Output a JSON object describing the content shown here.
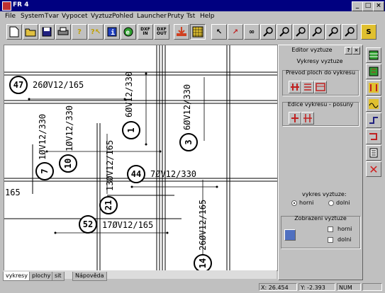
{
  "window": {
    "title": "FR 4",
    "min_label": "_",
    "max_label": "□",
    "close_label": "×"
  },
  "menu": [
    "File",
    "System",
    "Tvar",
    "Vypocet",
    "Vyztuz",
    "Pohled",
    "Launcher",
    "Pruty",
    "Tst",
    "Help"
  ],
  "toolbar": {
    "dxf_in": "DXF IN",
    "dxf_out": "DXF OUT",
    "s_btn": "S"
  },
  "drawing": {
    "labels": [
      {
        "id": "47",
        "text": "26ØV12/165"
      },
      {
        "id": "1",
        "text": "6ØV12/330"
      },
      {
        "id": "3",
        "text": "6ØV12/330"
      },
      {
        "id": "7",
        "text": "1ØV12/330"
      },
      {
        "id": "10",
        "text": "1ØV12/330"
      },
      {
        "id": "44",
        "text": "7ØV12/330"
      },
      {
        "id": "21",
        "text": "13ØV12/165"
      },
      {
        "id": "52",
        "text": "17ØV12/165"
      },
      {
        "id": "14",
        "text": "26ØV12/165"
      },
      {
        "id": "",
        "text": "165"
      }
    ]
  },
  "tabs": [
    "vykresy",
    "plochy",
    "sit",
    "Nápověda"
  ],
  "panel": {
    "title": "Editor vyztuze",
    "help": "?",
    "close": "×",
    "subtitle": "Vykresy vyztuze",
    "group1": "Prevod ploch do vykresu",
    "group2": "Edice vykresu - posuny",
    "vykres_label": "vykres vyztuze:",
    "radio_horni": "horni",
    "radio_dolni": "dolni",
    "group3": "Zobrazeni vyztuze",
    "chk_horni": "horni",
    "chk_dolni": "dolni"
  },
  "status": {
    "x": "X: 26.454",
    "y": "Y: -2.393",
    "mode": "NUM"
  }
}
